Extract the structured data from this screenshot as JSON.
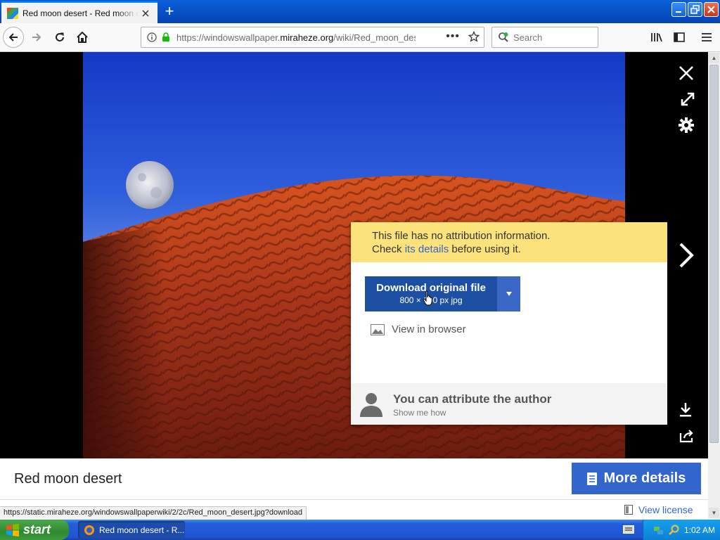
{
  "browser": {
    "tab_title": "Red moon desert - Red moon desert",
    "url_prefix": "https://windowswallpaper.",
    "url_domain": "miraheze.org",
    "url_path": "/wiki/Red_moon_desert",
    "search_placeholder": "Search"
  },
  "dialog": {
    "warning_line1": "This file has no attribution information.",
    "warning_check": "Check ",
    "warning_link": "its details",
    "warning_rest": " before using it.",
    "download_label": "Download original file",
    "download_meta": "800 × 600 px jpg",
    "view_in_browser": "View in browser",
    "attribute_title": "You can attribute the author",
    "attribute_sub": "Show me how"
  },
  "file": {
    "title": "Red moon desert",
    "more_details": "More details",
    "view_license": "View license"
  },
  "status": {
    "link": "https://static.miraheze.org/windowswallpaperwiki/2/2c/Red_moon_desert.jpg?download"
  },
  "taskbar": {
    "start": "start",
    "task_label": "Red moon desert - R...",
    "clock": "1:02 AM"
  },
  "colors": {
    "accent": "#3366cc",
    "download_button": "#1d4fa2",
    "warning_background": "#fce27a"
  }
}
